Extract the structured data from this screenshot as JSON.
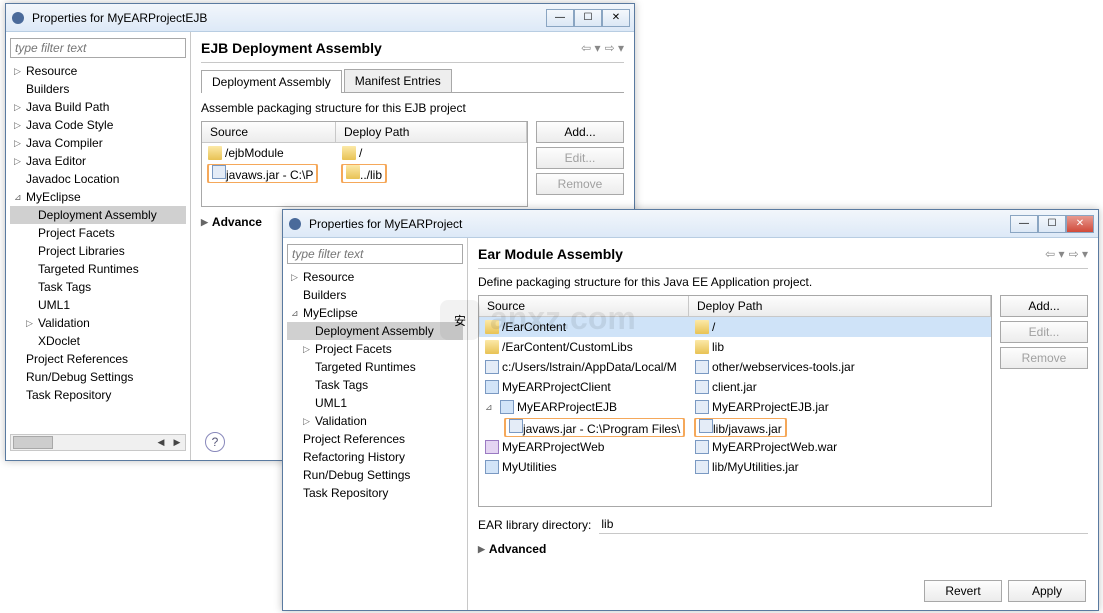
{
  "win1": {
    "title": "Properties for MyEARProjectEJB",
    "filter_placeholder": "type filter text",
    "tree": [
      {
        "label": "Resource",
        "arrow": "▷",
        "indent": 0
      },
      {
        "label": "Builders",
        "arrow": "",
        "indent": 0
      },
      {
        "label": "Java Build Path",
        "arrow": "▷",
        "indent": 0
      },
      {
        "label": "Java Code Style",
        "arrow": "▷",
        "indent": 0
      },
      {
        "label": "Java Compiler",
        "arrow": "▷",
        "indent": 0
      },
      {
        "label": "Java Editor",
        "arrow": "▷",
        "indent": 0
      },
      {
        "label": "Javadoc Location",
        "arrow": "",
        "indent": 0
      },
      {
        "label": "MyEclipse",
        "arrow": "⊿",
        "indent": 0
      },
      {
        "label": "Deployment Assembly",
        "arrow": "",
        "indent": 1,
        "sel": true
      },
      {
        "label": "Project Facets",
        "arrow": "",
        "indent": 1
      },
      {
        "label": "Project Libraries",
        "arrow": "",
        "indent": 1
      },
      {
        "label": "Targeted Runtimes",
        "arrow": "",
        "indent": 1
      },
      {
        "label": "Task Tags",
        "arrow": "",
        "indent": 1
      },
      {
        "label": "UML1",
        "arrow": "",
        "indent": 1
      },
      {
        "label": "Validation",
        "arrow": "▷",
        "indent": 1
      },
      {
        "label": "XDoclet",
        "arrow": "",
        "indent": 1
      },
      {
        "label": "Project References",
        "arrow": "",
        "indent": 0
      },
      {
        "label": "Run/Debug Settings",
        "arrow": "",
        "indent": 0
      },
      {
        "label": "Task Repository",
        "arrow": "",
        "indent": 0
      }
    ],
    "page_title": "EJB Deployment Assembly",
    "tabs": [
      "Deployment Assembly",
      "Manifest Entries"
    ],
    "desc": "Assemble packaging structure for this EJB project",
    "columns": {
      "source": "Source",
      "deploy": "Deploy Path"
    },
    "rows": [
      {
        "icon": "folder",
        "source": "/ejbModule",
        "dicon": "folder",
        "deploy": "/"
      },
      {
        "icon": "jar",
        "source": "javaws.jar - C:\\P",
        "dicon": "folder",
        "deploy": "../lib",
        "hl": true
      }
    ],
    "buttons": {
      "add": "Add...",
      "edit": "Edit...",
      "remove": "Remove"
    },
    "advanced": "Advance"
  },
  "win2": {
    "title": "Properties for MyEARProject",
    "filter_placeholder": "type filter text",
    "tree": [
      {
        "label": "Resource",
        "arrow": "▷",
        "indent": 0
      },
      {
        "label": "Builders",
        "arrow": "",
        "indent": 0
      },
      {
        "label": "MyEclipse",
        "arrow": "⊿",
        "indent": 0
      },
      {
        "label": "Deployment Assembly",
        "arrow": "",
        "indent": 1,
        "sel": true
      },
      {
        "label": "Project Facets",
        "arrow": "▷",
        "indent": 1
      },
      {
        "label": "Targeted Runtimes",
        "arrow": "",
        "indent": 1
      },
      {
        "label": "Task Tags",
        "arrow": "",
        "indent": 1
      },
      {
        "label": "UML1",
        "arrow": "",
        "indent": 1
      },
      {
        "label": "Validation",
        "arrow": "▷",
        "indent": 1
      },
      {
        "label": "Project References",
        "arrow": "",
        "indent": 0
      },
      {
        "label": "Refactoring History",
        "arrow": "",
        "indent": 0
      },
      {
        "label": "Run/Debug Settings",
        "arrow": "",
        "indent": 0
      },
      {
        "label": "Task Repository",
        "arrow": "",
        "indent": 0
      }
    ],
    "page_title": "Ear Module Assembly",
    "desc": "Define packaging structure for this Java EE Application project.",
    "columns": {
      "source": "Source",
      "deploy": "Deploy Path"
    },
    "rows": [
      {
        "icon": "folder",
        "source": "/EarContent",
        "dicon": "folder",
        "deploy": "/",
        "sel": true
      },
      {
        "icon": "folder",
        "source": "/EarContent/CustomLibs",
        "dicon": "folder",
        "deploy": "lib"
      },
      {
        "icon": "jar",
        "source": "c:/Users/lstrain/AppData/Local/M",
        "dicon": "jar",
        "deploy": "other/webservices-tools.jar"
      },
      {
        "icon": "proj",
        "source": "MyEARProjectClient",
        "dicon": "jar",
        "deploy": "client.jar"
      },
      {
        "icon": "proj",
        "source": "MyEARProjectEJB",
        "dicon": "jar",
        "deploy": "MyEARProjectEJB.jar",
        "expand": "⊿"
      },
      {
        "icon": "jar",
        "source": "javaws.jar - C:\\Program Files\\",
        "dicon": "jar",
        "deploy": "lib/javaws.jar",
        "indent": true,
        "hl": true
      },
      {
        "icon": "mod",
        "source": "MyEARProjectWeb",
        "dicon": "jar",
        "deploy": "MyEARProjectWeb.war"
      },
      {
        "icon": "proj",
        "source": "MyUtilities",
        "dicon": "jar",
        "deploy": "lib/MyUtilities.jar"
      }
    ],
    "buttons": {
      "add": "Add...",
      "edit": "Edit...",
      "remove": "Remove"
    },
    "lib_dir_label": "EAR library directory:",
    "lib_dir_value": "lib",
    "advanced": "Advanced",
    "revert": "Revert",
    "apply": "Apply"
  }
}
